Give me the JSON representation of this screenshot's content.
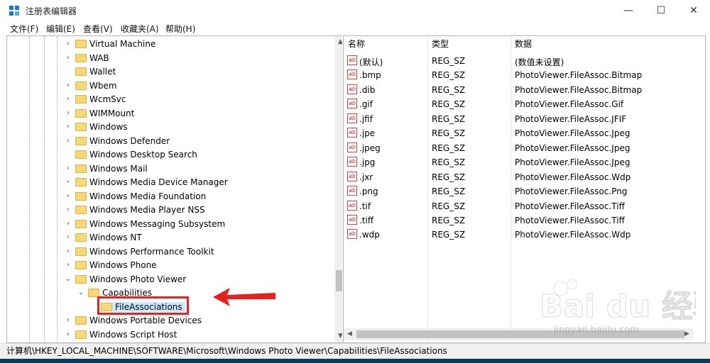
{
  "window": {
    "title": "注册表编辑器",
    "minimize": "—",
    "maximize": "☐",
    "close": "✕"
  },
  "menu": [
    "文件(F)",
    "编辑(E)",
    "查看(V)",
    "收藏夹(A)",
    "帮助(H)"
  ],
  "tree": {
    "items": [
      {
        "label": "Virtual Machine",
        "expander": "collapsed"
      },
      {
        "label": "WAB",
        "expander": "collapsed"
      },
      {
        "label": "Wallet",
        "expander": "none"
      },
      {
        "label": "Wbem",
        "expander": "collapsed"
      },
      {
        "label": "WcmSvc",
        "expander": "collapsed"
      },
      {
        "label": "WIMMount",
        "expander": "collapsed"
      },
      {
        "label": "Windows",
        "expander": "collapsed"
      },
      {
        "label": "Windows Defender",
        "expander": "collapsed"
      },
      {
        "label": "Windows Desktop Search",
        "expander": "none"
      },
      {
        "label": "Windows Mail",
        "expander": "collapsed"
      },
      {
        "label": "Windows Media Device Manager",
        "expander": "collapsed"
      },
      {
        "label": "Windows Media Foundation",
        "expander": "collapsed"
      },
      {
        "label": "Windows Media Player NSS",
        "expander": "collapsed"
      },
      {
        "label": "Windows Messaging Subsystem",
        "expander": "collapsed"
      },
      {
        "label": "Windows NT",
        "expander": "collapsed"
      },
      {
        "label": "Windows Performance Toolkit",
        "expander": "collapsed"
      },
      {
        "label": "Windows Phone",
        "expander": "collapsed"
      },
      {
        "label": "Windows Photo Viewer",
        "expander": "expanded"
      },
      {
        "label": "Capabilities",
        "expander": "expanded"
      },
      {
        "label": "FileAssociations",
        "expander": "none",
        "selected": true
      },
      {
        "label": "Windows Portable Devices",
        "expander": "collapsed"
      },
      {
        "label": "Windows Script Host",
        "expander": "collapsed"
      }
    ]
  },
  "list": {
    "columns": [
      "名称",
      "类型",
      "数据"
    ],
    "rows": [
      {
        "name": "(默认)",
        "type": "REG_SZ",
        "data": "(数值未设置)"
      },
      {
        "name": ".bmp",
        "type": "REG_SZ",
        "data": "PhotoViewer.FileAssoc.Bitmap"
      },
      {
        "name": ".dib",
        "type": "REG_SZ",
        "data": "PhotoViewer.FileAssoc.Bitmap"
      },
      {
        "name": ".gif",
        "type": "REG_SZ",
        "data": "PhotoViewer.FileAssoc.Gif"
      },
      {
        "name": ".jfif",
        "type": "REG_SZ",
        "data": "PhotoViewer.FileAssoc.JFIF"
      },
      {
        "name": ".jpe",
        "type": "REG_SZ",
        "data": "PhotoViewer.FileAssoc.Jpeg"
      },
      {
        "name": ".jpeg",
        "type": "REG_SZ",
        "data": "PhotoViewer.FileAssoc.Jpeg"
      },
      {
        "name": ".jpg",
        "type": "REG_SZ",
        "data": "PhotoViewer.FileAssoc.Jpeg"
      },
      {
        "name": ".jxr",
        "type": "REG_SZ",
        "data": "PhotoViewer.FileAssoc.Wdp"
      },
      {
        "name": ".png",
        "type": "REG_SZ",
        "data": "PhotoViewer.FileAssoc.Png"
      },
      {
        "name": ".tif",
        "type": "REG_SZ",
        "data": "PhotoViewer.FileAssoc.Tiff"
      },
      {
        "name": ".tiff",
        "type": "REG_SZ",
        "data": "PhotoViewer.FileAssoc.Tiff"
      },
      {
        "name": ".wdp",
        "type": "REG_SZ",
        "data": "PhotoViewer.FileAssoc.Wdp"
      }
    ],
    "value_icon": "ab"
  },
  "status": {
    "path": "计算机\\HKEY_LOCAL_MACHINE\\SOFTWARE\\Microsoft\\Windows Photo Viewer\\Capabilities\\FileAssociations"
  },
  "watermark": {
    "brand": "Bai du 经验",
    "url": "jingyan.baidu.com"
  },
  "colors": {
    "annotation": "#e8201e",
    "folder": "#f8d775",
    "selection": "#cce8ff"
  }
}
